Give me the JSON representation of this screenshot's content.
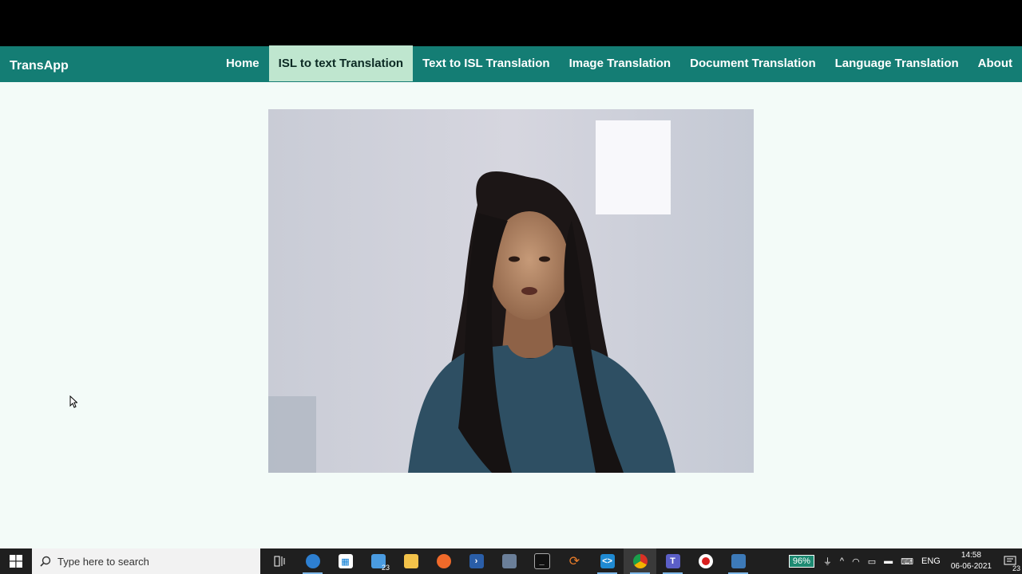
{
  "nav": {
    "brand": "TransApp",
    "links": [
      {
        "label": "Home"
      },
      {
        "label": "ISL to text Translation",
        "active": true
      },
      {
        "label": "Text to ISL Translation"
      },
      {
        "label": "Image Translation"
      },
      {
        "label": "Document Translation"
      },
      {
        "label": "Language Translation"
      },
      {
        "label": "About"
      }
    ]
  },
  "colors": {
    "navbar": "#147d74",
    "active_tab": "#bfe6cf",
    "page_bg": "#f3fbf8",
    "topbar": "#000000",
    "taskbar": "#1f1f1f"
  },
  "taskbar": {
    "search_placeholder": "Type here to search",
    "apps": [
      {
        "icon": "task-view-icon"
      },
      {
        "icon": "edge-icon",
        "running": true
      },
      {
        "icon": "store-icon"
      },
      {
        "icon": "mail-icon",
        "badge": "23"
      },
      {
        "icon": "file-explorer-icon"
      },
      {
        "icon": "firefox-icon"
      },
      {
        "icon": "powershell-icon"
      },
      {
        "icon": "app-window-icon"
      },
      {
        "icon": "terminal-icon"
      },
      {
        "icon": "refresh-app-icon"
      },
      {
        "icon": "vscode-icon",
        "running": true
      },
      {
        "icon": "chrome-icon",
        "running": true,
        "active": true
      },
      {
        "icon": "teams-icon",
        "running": true
      },
      {
        "icon": "record-icon"
      },
      {
        "icon": "photos-icon",
        "running": true
      }
    ],
    "tray": {
      "battery": "96%",
      "language": "ENG",
      "time": "14:58",
      "date": "06-06-2021",
      "notifications": "23"
    }
  }
}
